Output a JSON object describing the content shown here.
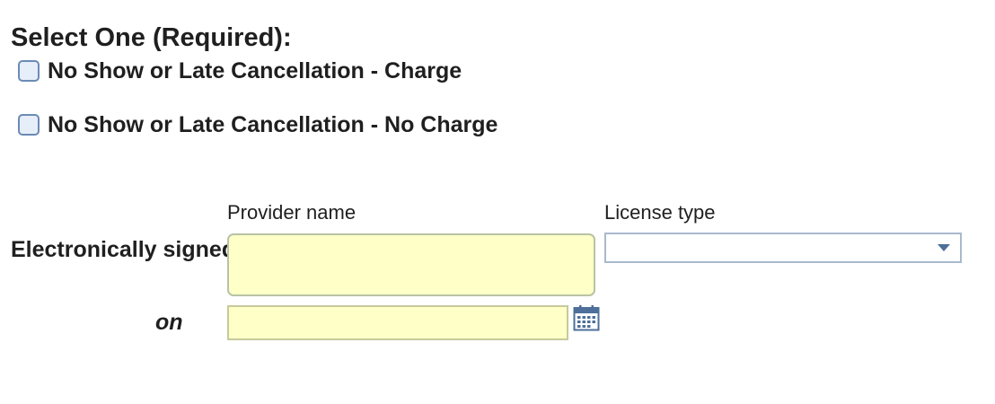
{
  "form": {
    "heading": "Select One (Required):",
    "options": [
      {
        "label": "No Show or Late Cancellation - Charge",
        "checked": false
      },
      {
        "label": "No Show or Late Cancellation - No Charge",
        "checked": false
      }
    ]
  },
  "signature": {
    "signed_by_label": "Electronically signed by",
    "on_label": "on",
    "provider_name_label": "Provider name",
    "provider_name_value": "",
    "license_type_label": "License type",
    "license_type_value": "",
    "date_value": ""
  },
  "icons": {
    "dropdown": "chevron-down-icon",
    "calendar": "calendar-icon"
  },
  "colors": {
    "required_field_bg": "#ffffc8",
    "checkbox_border": "#6b8bb5",
    "checkbox_fill": "#e6eef9",
    "accent": "#4d6f99"
  }
}
